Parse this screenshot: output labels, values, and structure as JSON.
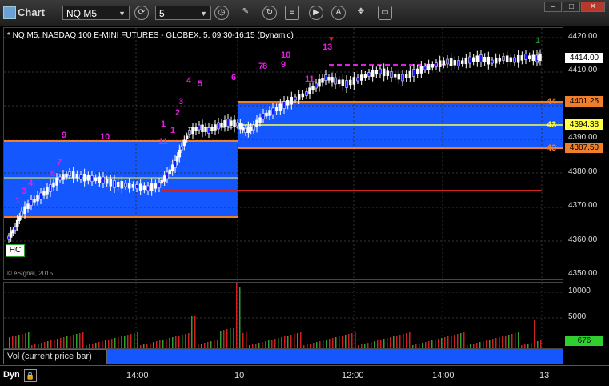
{
  "window": {
    "title": "Chart"
  },
  "toolbar": {
    "symbol": "NQ M5",
    "interval": "5",
    "icons": [
      "refresh-icon",
      "clock-icon",
      "pencil-icon",
      "cycle-icon",
      "list-icon",
      "play-icon",
      "alert-icon",
      "drag-icon",
      "chat-icon"
    ]
  },
  "chart": {
    "info": "* NQ M5, NASDAQ 100 E-MINI FUTURES - GLOBEX, 5, 09:30-16:15 (Dynamic)",
    "copyright": "© eSignal, 2015",
    "price_ticks": [
      "4420.00",
      "4410.00",
      "4390.00",
      "4380.00",
      "4370.00",
      "4360.00",
      "4350.00"
    ],
    "price_labels": [
      {
        "text": "4414.00",
        "bg": "#ffffff",
        "fg": "#000000"
      },
      {
        "text": "4401.25",
        "bg": "#f07f2c",
        "fg": "#000000"
      },
      {
        "text": "4394.38",
        "bg": "#ffff44",
        "fg": "#000000"
      },
      {
        "text": "4387.50",
        "bg": "#f07f2c",
        "fg": "#000000"
      }
    ],
    "level_tags": [
      "44",
      "43",
      "43"
    ],
    "candle_markers": [
      "10",
      "11",
      "1",
      "3",
      "4",
      "5",
      "6",
      "7",
      "8",
      "9",
      "1",
      "2",
      "3",
      "4",
      "5",
      "11",
      "13"
    ],
    "box_labels": [
      "HC"
    ]
  },
  "volume": {
    "label": "Vol (current price bar)",
    "ticks": [
      "10000",
      "5000"
    ],
    "current": "676"
  },
  "time_axis": {
    "dyn_label": "Dyn",
    "ticks": [
      "14:00",
      "10",
      "12:00",
      "14:00",
      "13"
    ]
  },
  "colors": {
    "zone_blue": "#1457ff",
    "orange_line": "#f07f2c",
    "yellow_line": "#ffff44",
    "red_line": "#d02020",
    "magenta_marker": "#e020e0",
    "green_label": "#2f9f2f"
  }
}
